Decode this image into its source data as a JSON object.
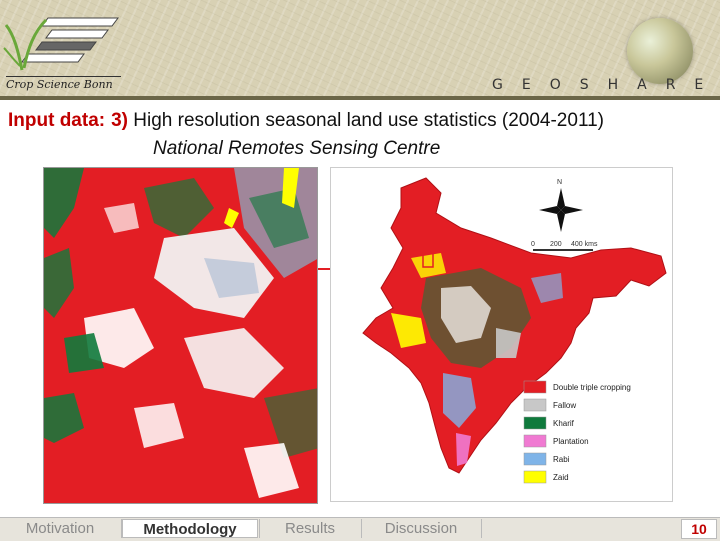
{
  "header": {
    "brand_name": "Crop Science Bonn",
    "partner_name": "GEOSHARE"
  },
  "title": {
    "label": "Input data:",
    "number": "3)",
    "text": "High resolution seasonal land use statistics (2004-2011)",
    "subtitle": "National Remotes Sensing Centre"
  },
  "map": {
    "north_label": "N",
    "scale_labels": [
      "0",
      "200",
      "400 kms"
    ],
    "legend": [
      {
        "label": "Double triple cropping",
        "color": "#e31e24"
      },
      {
        "label": "Fallow",
        "color": "#c8c8c8"
      },
      {
        "label": "Kharif",
        "color": "#0f7a3c"
      },
      {
        "label": "Plantation",
        "color": "#f07ad2"
      },
      {
        "label": "Rabi",
        "color": "#7fb4e8"
      },
      {
        "label": "Zaid",
        "color": "#ffff00"
      }
    ]
  },
  "footer": {
    "nav": [
      {
        "label": "Motivation",
        "active": false
      },
      {
        "label": "Methodology",
        "active": true
      },
      {
        "label": "Results",
        "active": false
      },
      {
        "label": "Discussion",
        "active": false
      }
    ],
    "page_number": "10"
  }
}
